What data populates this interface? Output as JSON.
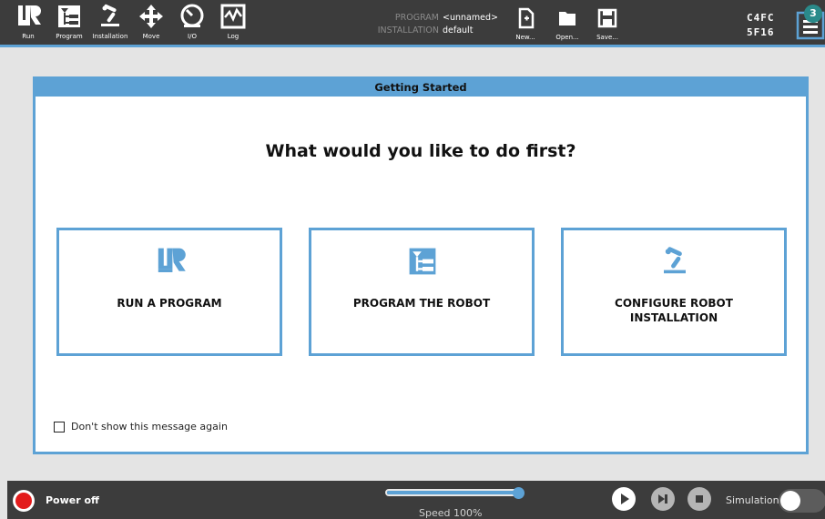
{
  "nav": [
    {
      "label": "Run",
      "icon": "ur-logo-icon"
    },
    {
      "label": "Program",
      "icon": "program-tree-icon"
    },
    {
      "label": "Installation",
      "icon": "robot-arm-icon"
    },
    {
      "label": "Move",
      "icon": "move-arrows-icon"
    },
    {
      "label": "I/O",
      "icon": "io-gauge-icon"
    },
    {
      "label": "Log",
      "icon": "log-chart-icon"
    }
  ],
  "program_info": {
    "program_key": "PROGRAM",
    "program_value": "<unnamed>",
    "installation_key": "INSTALLATION",
    "installation_value": "default"
  },
  "file_buttons": {
    "new": "New...",
    "open": "Open...",
    "save": "Save..."
  },
  "robot_id": {
    "line1": "C4FC",
    "line2": "5F16"
  },
  "menu": {
    "badge": "3",
    "icon": "hamburger-menu-icon"
  },
  "dialog": {
    "header": "Getting Started",
    "title": "What would you like to do first?",
    "choices": [
      {
        "label": "RUN A PROGRAM",
        "icon": "ur-logo-icon"
      },
      {
        "label": "PROGRAM THE ROBOT",
        "icon": "program-tree-icon"
      },
      {
        "label": "CONFIGURE ROBOT INSTALLATION",
        "icon": "robot-arm-icon"
      }
    ],
    "checkbox_label": "Don't show this message again",
    "checkbox_checked": false
  },
  "bottom": {
    "power_label": "Power off",
    "speed_label": "Speed 100%",
    "speed_value": 100,
    "simulation_label": "Simulation",
    "simulation_on": false
  },
  "colors": {
    "accent": "#5da2d5",
    "bar": "#3c3c3c",
    "power": "#e31b1b"
  }
}
